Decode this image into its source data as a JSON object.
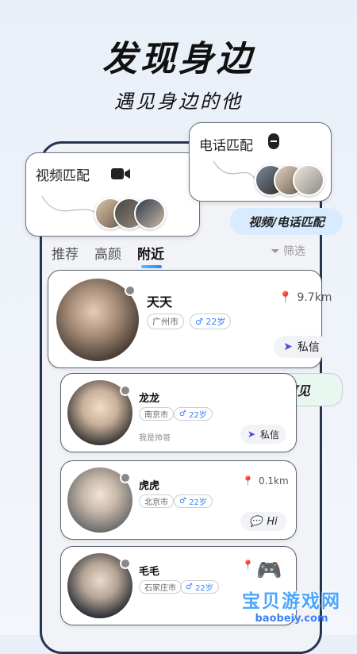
{
  "headline": "发现身边",
  "subline": "遇见身边的他",
  "video_bubble": {
    "title": "视频匹配",
    "icon": "video-camera-icon"
  },
  "phone_bubble": {
    "title": "电话匹配",
    "icon": "phone-icon"
  },
  "tags": {
    "match": "视频/电话匹配",
    "nearby": "附近可见"
  },
  "tabs": {
    "recommend": "推荐",
    "looks": "高颜",
    "nearby": "附近",
    "filter": "筛选"
  },
  "users": [
    {
      "name": "天天",
      "city": "广州市",
      "age": "22岁",
      "distance": "9.7km",
      "action": "私信",
      "bio": ""
    },
    {
      "name": "龙龙",
      "city": "南京市",
      "age": "22岁",
      "distance": "",
      "action": "私信",
      "bio": "我是帅哥"
    },
    {
      "name": "虎虎",
      "city": "北京市",
      "age": "22岁",
      "distance": "0.1km",
      "action": "Hi",
      "bio": ""
    },
    {
      "name": "毛毛",
      "city": "石家庄市",
      "age": "22岁",
      "distance": "",
      "action": "",
      "bio": ""
    }
  ],
  "watermark": {
    "main": "宝贝游戏网",
    "url": "baobeiy.com"
  },
  "colors": {
    "accent": "#3b82f6",
    "pill_bg": "#d9ecff",
    "pill_nearby": "#e9f7f1"
  }
}
